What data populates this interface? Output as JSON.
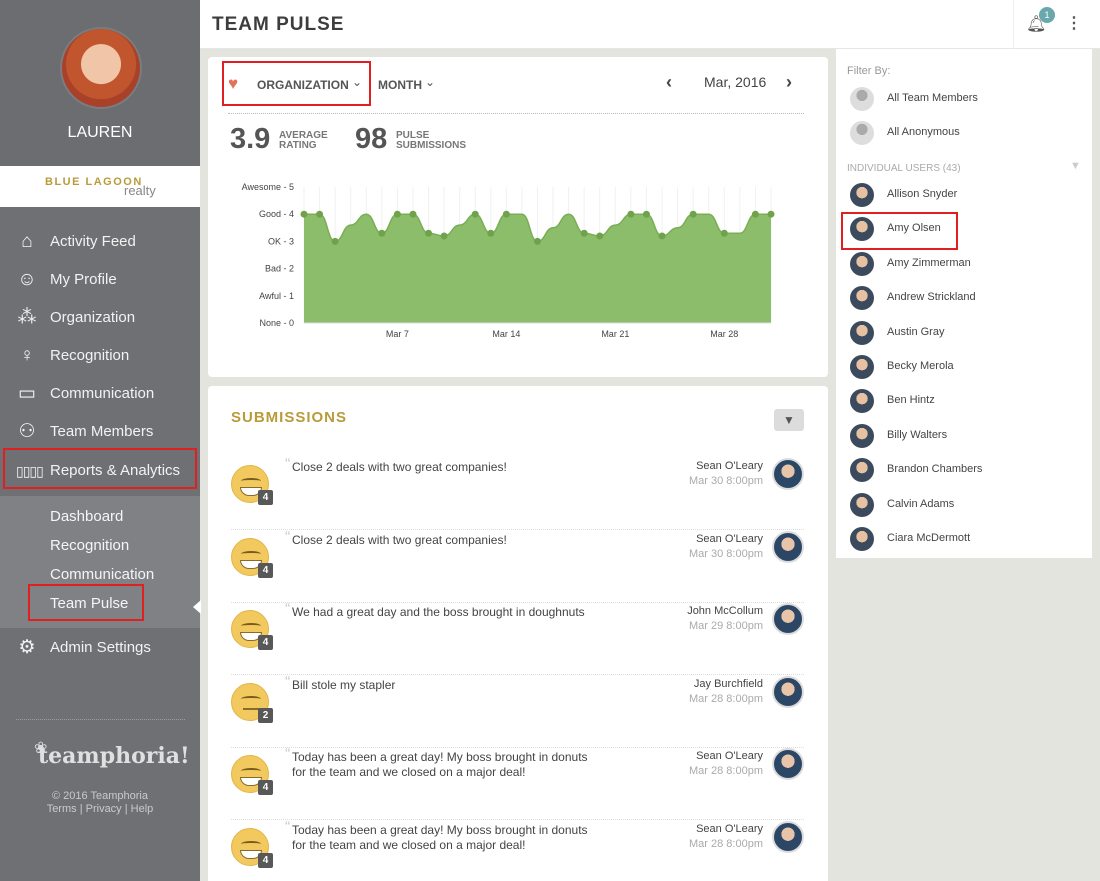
{
  "sidebar": {
    "user_name": "LAUREN",
    "brand": {
      "name": "BLUE LAGOON",
      "sub": "realty"
    },
    "nav": [
      {
        "label": "Activity Feed",
        "icon": "home-icon"
      },
      {
        "label": "My Profile",
        "icon": "user-icon"
      },
      {
        "label": "Organization",
        "icon": "organization-icon"
      },
      {
        "label": "Recognition",
        "icon": "ribbon-icon"
      },
      {
        "label": "Communication",
        "icon": "chat-icon"
      },
      {
        "label": "Team Members",
        "icon": "team-icon"
      },
      {
        "label": "Reports & Analytics",
        "icon": "bars-icon"
      },
      {
        "label": "Admin Settings",
        "icon": "gear-icon"
      }
    ],
    "subnav": [
      "Dashboard",
      "Recognition",
      "Communication",
      "Team Pulse"
    ],
    "logo": "teamphoria!",
    "copyright": "© 2016 Teamphoria",
    "footer_links": [
      "Terms",
      "Privacy",
      "Help"
    ]
  },
  "header": {
    "title": "TEAM PULSE",
    "notification_count": "1"
  },
  "pulse": {
    "scope_label": "ORGANIZATION",
    "period_label": "MONTH",
    "date": "Mar, 2016",
    "average_rating": "3.9",
    "average_label_1": "AVERAGE",
    "average_label_2": "RATING",
    "submissions_count": "98",
    "submissions_label_1": "PULSE",
    "submissions_label_2": "SUBMISSIONS"
  },
  "chart_data": {
    "type": "area",
    "y_categories": [
      "None - 0",
      "Awful - 1",
      "Bad - 2",
      "OK - 3",
      "Good - 4",
      "Awesome - 5"
    ],
    "ylim": [
      0,
      5
    ],
    "x_ticks": [
      "Mar 7",
      "Mar 14",
      "Mar 21",
      "Mar 28"
    ],
    "x": [
      1,
      2,
      3,
      4,
      5,
      6,
      7,
      8,
      9,
      10,
      11,
      12,
      13,
      14,
      15,
      16,
      17,
      18,
      19,
      20,
      21,
      22,
      23,
      24,
      25,
      26,
      27,
      28,
      29,
      30,
      31
    ],
    "values": [
      4,
      4,
      3,
      3.6,
      4,
      3.3,
      4,
      4,
      3.3,
      3.2,
      3.6,
      4,
      3.3,
      4,
      4,
      3,
      3.5,
      4,
      3.3,
      3.2,
      3.6,
      4,
      4,
      3.2,
      3.5,
      4,
      4,
      3.3,
      3.3,
      4,
      4
    ],
    "dot_days": [
      1,
      2,
      3,
      6,
      7,
      8,
      9,
      10,
      12,
      13,
      14,
      16,
      19,
      20,
      22,
      23,
      24,
      26,
      28,
      30,
      31
    ],
    "color": "#8cbd6a"
  },
  "submissions": {
    "title": "SUBMISSIONS",
    "items": [
      {
        "score": "4",
        "text": "Close 2 deals with two great companies!",
        "author": "Sean O'Leary",
        "time": "Mar 30 8:00pm"
      },
      {
        "score": "4",
        "text": "Close 2 deals with two great companies!",
        "author": "Sean O'Leary",
        "time": "Mar 30 8:00pm"
      },
      {
        "score": "4",
        "text": "We had a great day and the boss brought in doughnuts",
        "author": "John McCollum",
        "time": "Mar 29 8:00pm"
      },
      {
        "score": "2",
        "text": "Bill stole my stapler",
        "author": "Jay Burchfield",
        "time": "Mar 28 8:00pm"
      },
      {
        "score": "4",
        "text": "Today has been a great day! My boss brought in donuts for the team and we closed on a major deal!",
        "author": "Sean O'Leary",
        "time": "Mar 28 8:00pm"
      },
      {
        "score": "4",
        "text": "Today has been a great day! My boss brought in donuts for the team and we closed on a major deal!",
        "author": "Sean O'Leary",
        "time": "Mar 28 8:00pm"
      }
    ]
  },
  "filter": {
    "label": "Filter By:",
    "groups": [
      "All Team Members",
      "All Anonymous"
    ],
    "users_heading": "INDIVIDUAL USERS (43)",
    "users": [
      "Allison Snyder",
      "Amy Olsen",
      "Amy Zimmerman",
      "Andrew Strickland",
      "Austin Gray",
      "Becky Merola",
      "Ben Hintz",
      "Billy Walters",
      "Brandon Chambers",
      "Calvin Adams",
      "Ciara McDermott"
    ]
  }
}
